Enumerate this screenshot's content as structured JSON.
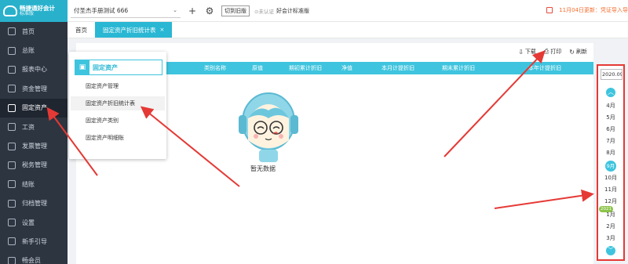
{
  "app": {
    "name": "畅捷通好会计",
    "tag": "标准版"
  },
  "sidebar": {
    "items": [
      {
        "label": "首页",
        "icon": "home-icon"
      },
      {
        "label": "总账",
        "icon": "ledger-icon"
      },
      {
        "label": "报表中心",
        "icon": "report-icon"
      },
      {
        "label": "资金管理",
        "icon": "fund-icon"
      },
      {
        "label": "固定资产",
        "icon": "fixed-asset-icon"
      },
      {
        "label": "工资",
        "icon": "salary-icon"
      },
      {
        "label": "发票管理",
        "icon": "invoice-icon"
      },
      {
        "label": "税务管理",
        "icon": "tax-icon"
      },
      {
        "label": "结账",
        "icon": "close-books-icon"
      },
      {
        "label": "归档管理",
        "icon": "archive-icon"
      },
      {
        "label": "设置",
        "icon": "settings-icon"
      },
      {
        "label": "新手引导",
        "icon": "guide-icon"
      },
      {
        "label": "畅会员",
        "icon": "member-icon"
      }
    ],
    "active_index": 4
  },
  "topbar": {
    "company": "付圣杰手册测试 666",
    "switch_old": "切到旧版",
    "verify": "未认证",
    "edition": "好会计标准版",
    "notice": "11月04日更新：凭证导入导"
  },
  "tabs": [
    {
      "label": "首页"
    },
    {
      "label": "固定资产折旧统计表",
      "closable": "×"
    }
  ],
  "toolbar": {
    "download": "下载",
    "print": "打印",
    "refresh": "刷新"
  },
  "table": {
    "columns": [
      "类别名称",
      "原值",
      "期初累计折旧",
      "净值",
      "本月计提折旧",
      "期末累计折旧",
      "本年计提折旧"
    ]
  },
  "empty_text": "暂无数据",
  "menu": {
    "header": "固定资产",
    "items": [
      "固定资产管理",
      "固定资产折旧统计表",
      "固定资产类别",
      "固定资产明细账"
    ]
  },
  "months": {
    "year_value": "2020.09",
    "items": [
      "4月",
      "5月",
      "6月",
      "7月",
      "8月",
      "9月",
      "10月",
      "11月",
      "12月",
      "1月",
      "2月",
      "3月"
    ],
    "selected": "9月",
    "year_badge": "2021"
  },
  "colors": {
    "accent": "#29b7d3",
    "sidebar_bg": "#2d3541",
    "arrow": "#e53935"
  }
}
